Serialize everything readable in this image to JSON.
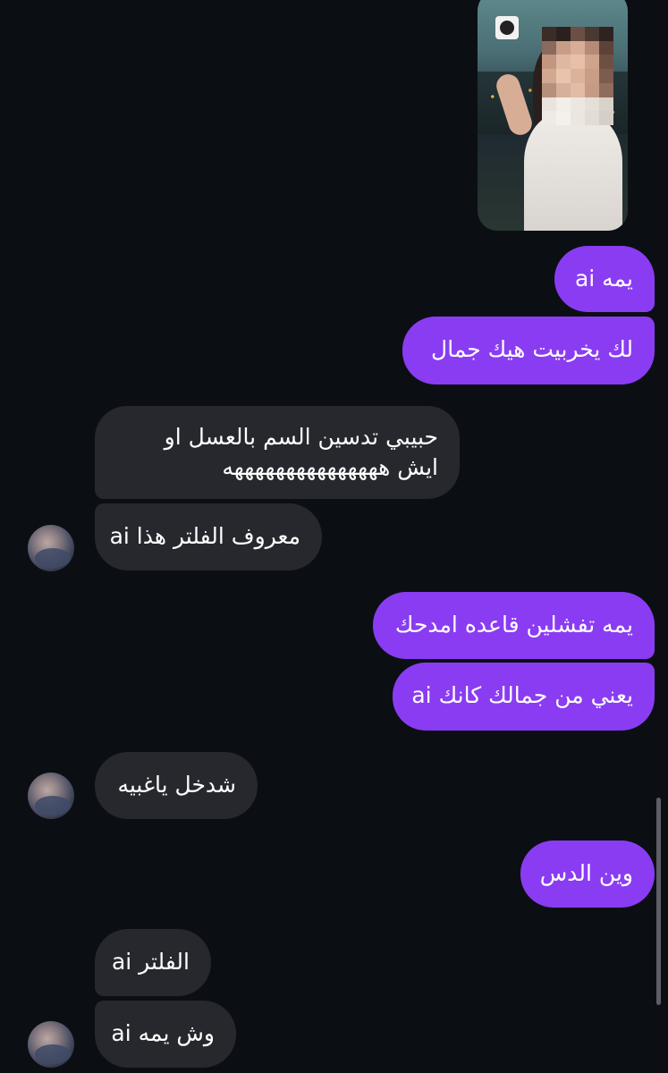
{
  "colors": {
    "background": "#0b0f14",
    "outgoing_bubble": "#8a3cf2",
    "incoming_bubble": "#26282d",
    "text": "#ffffff"
  },
  "messages": [
    {
      "id": 1,
      "direction": "outgoing",
      "text": "يمه ai"
    },
    {
      "id": 2,
      "direction": "outgoing",
      "text": "لك يخربيت هيك جمال"
    },
    {
      "id": 3,
      "direction": "incoming",
      "text": "حبيبي تدسين السم بالعسل او ايش هههههههههههههههه"
    },
    {
      "id": 4,
      "direction": "incoming",
      "text": "معروف الفلتر هذا ai"
    },
    {
      "id": 5,
      "direction": "outgoing",
      "text": "يمه تفشلين قاعده امدحك"
    },
    {
      "id": 6,
      "direction": "outgoing",
      "text": "يعني من جمالك كانك ai"
    },
    {
      "id": 7,
      "direction": "incoming",
      "text": "شدخل ياغبيه"
    },
    {
      "id": 8,
      "direction": "outgoing",
      "text": "وين الدس"
    },
    {
      "id": 9,
      "direction": "incoming",
      "text": "الفلتر ai"
    },
    {
      "id": 10,
      "direction": "incoming",
      "text": "وش يمه ai"
    }
  ]
}
